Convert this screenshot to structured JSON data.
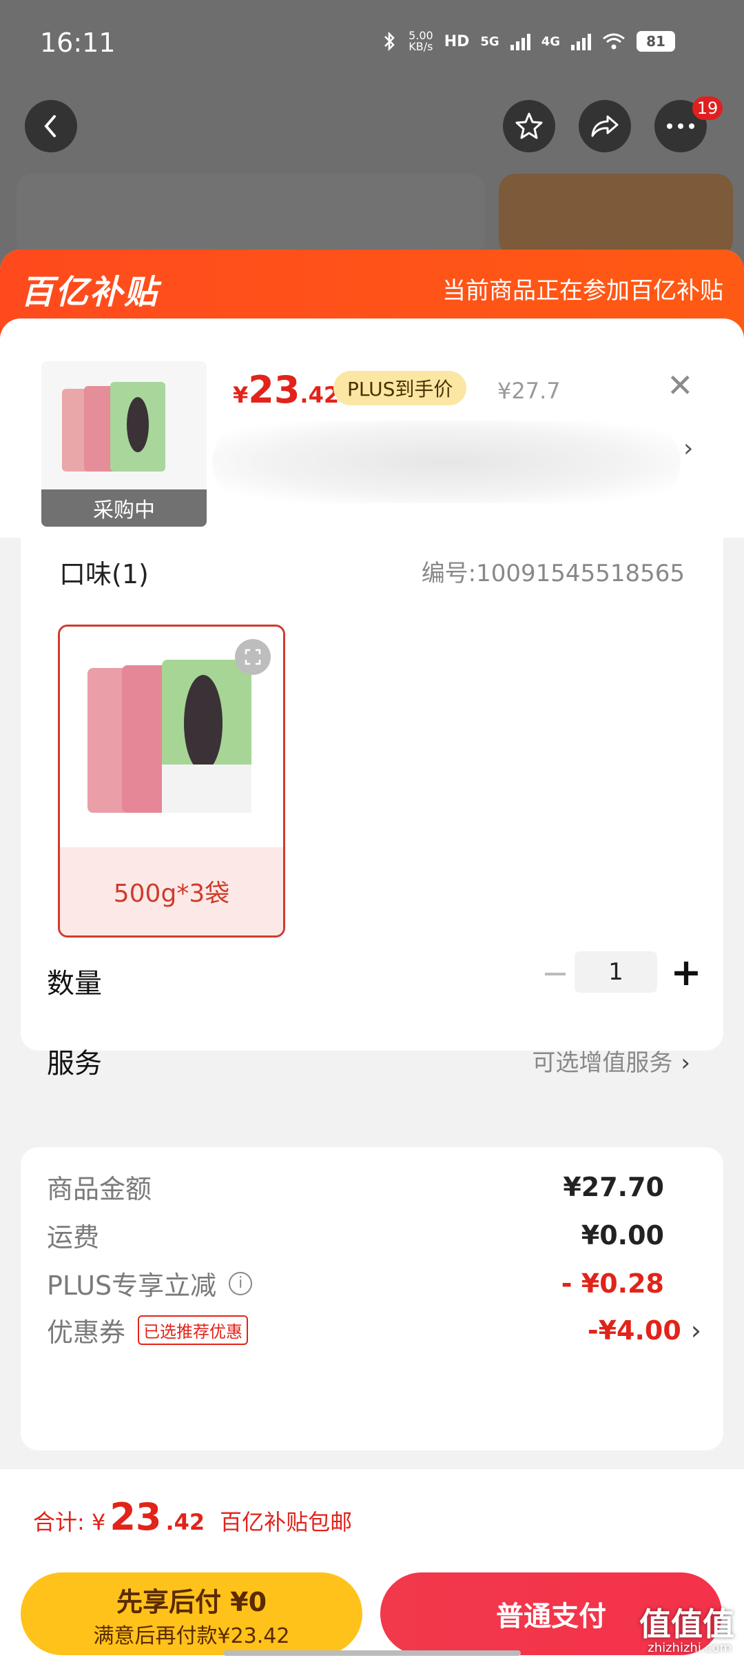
{
  "status_bar": {
    "time": "16:11",
    "speed": "5.00",
    "speed_unit": "KB/s",
    "hd": "HD",
    "net1": "5G",
    "net2": "4G",
    "battery": "81"
  },
  "nav": {
    "back_icon": "chevron-left-icon",
    "favorite_icon": "star-icon",
    "share_icon": "share-icon",
    "more_icon": "more-dots-icon",
    "more_badge": "19"
  },
  "banner": {
    "logo": "百亿补贴",
    "description": "当前商品正在参加百亿补贴"
  },
  "product": {
    "price_currency": "¥",
    "price_int": "23",
    "price_dec": ".42",
    "plus_tag": "PLUS到手价",
    "original_price": "¥27.7",
    "thumb_tag": "采购中"
  },
  "spec": {
    "title": "口味(1)",
    "product_no": "编号:10091545518565",
    "option_label": "500g*3袋"
  },
  "quantity": {
    "label": "数量",
    "value": "1",
    "minus": "−",
    "plus": "+"
  },
  "service": {
    "label": "服务",
    "value": "可选增值服务"
  },
  "summary": {
    "items": [
      {
        "label": "商品金额",
        "value": "¥27.70"
      },
      {
        "label": "运费",
        "value": "¥0.00"
      },
      {
        "label": "PLUS专享立减",
        "value": "- ¥0.28"
      },
      {
        "label": "优惠券",
        "tag": "已选推荐优惠",
        "value": "-¥4.00"
      }
    ]
  },
  "footer": {
    "total_prefix": "合计: ¥",
    "total_int": "23",
    "total_dec": ".42",
    "total_note": "百亿补贴包邮",
    "later_line1": "先享后付 ¥0",
    "later_line2": "满意后再付款¥23.42",
    "pay_label": "普通支付"
  },
  "watermark": {
    "main": "值值值",
    "sub": "zhizhizhi.com"
  },
  "colors": {
    "accent_red": "#e2231a",
    "banner_orange": "#ff4a1d",
    "plus_gold": "#fbe6a4",
    "later_yellow": "#ffc21a",
    "pay_red": "#f2384b"
  }
}
